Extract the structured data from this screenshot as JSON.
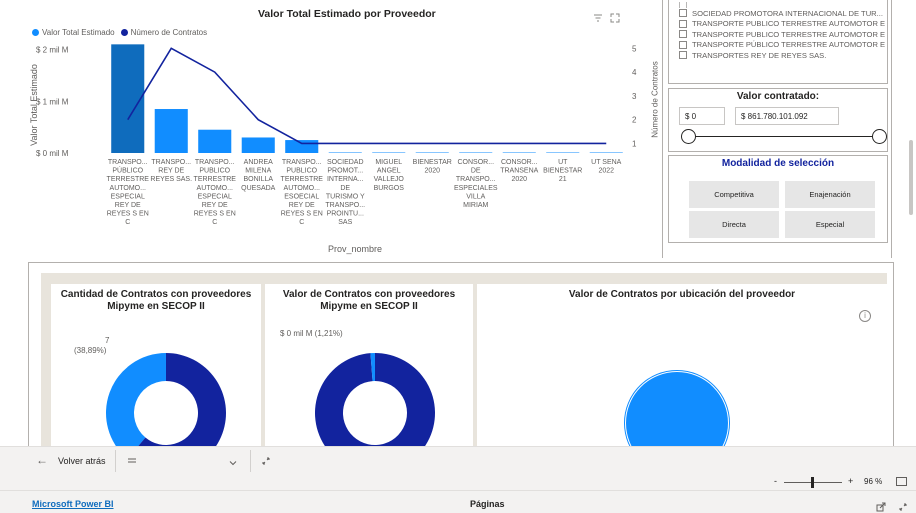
{
  "top_chart": {
    "title": "Valor Total Estimado por Proveedor",
    "legend": [
      {
        "label": "Valor Total Estimado",
        "color": "#118dff"
      },
      {
        "label": "Número de Contratos",
        "color": "#12239e"
      }
    ],
    "y_left_title": "Valor Total Estimado",
    "y_right_title": "Número de Contratos",
    "x_title": "Prov_nombre",
    "y_left_ticks": [
      "$ 2 mil M",
      "$ 1 mil M",
      "$ 0 mil M"
    ],
    "y_right_ticks": [
      "5",
      "4",
      "3",
      "2",
      "1"
    ],
    "focus_icon": "focus-icon",
    "filter_icon": "filter-icon"
  },
  "chart_data": {
    "type": "bar",
    "title": "Valor Total Estimado por Proveedor",
    "xlabel": "Prov_nombre",
    "ylabel": "Valor Total Estimado",
    "y2label": "Número de Contratos",
    "categories": [
      "TRANSPO... PÚBLICO TERRESTRE AUTOMO... ESPECIAL REY DE REYES S EN C",
      "TRANSPO... REY DE REYES SAS.",
      "TRANSPO... PUBLICO TERRESTRE AUTOMO... ESPECIAL REY DE REYES S EN C",
      "ANDREA MILENA BONILLA QUESADA",
      "TRANSPO... PUBLICO TERRESTRE AUTOMO... ESOECIAL REY DE REYES S EN C",
      "SOCIEDAD PROMOT... INTERNA... DE TURISMO Y TRANSPO... PROINTU... SAS",
      "MIGUEL ANGEL VALLEJO BURGOS",
      "BIENESTAR 2020",
      "CONSOR... DE TRANSPO... ESPECIALES VILLA MIRIAM",
      "CONSOR... TRANSENA 2020",
      "UT BIENESTAR 21",
      "UT SENA 2022"
    ],
    "x_label_lines": [
      [
        "TRANSPO...",
        "PÚBLICO",
        "TERRESTRE",
        "AUTOMO...",
        "ESPECIAL",
        "REY DE",
        "REYES S EN",
        "C"
      ],
      [
        "TRANSPO...",
        "REY DE",
        "REYES SAS."
      ],
      [
        "TRANSPO...",
        "PUBLICO",
        "TERRESTRE",
        "AUTOMO...",
        "ESPECIAL",
        "REY DE",
        "REYES S EN",
        "C"
      ],
      [
        "ANDREA",
        "MILENA",
        "BONILLA",
        "QUESADA"
      ],
      [
        "TRANSPO...",
        "PUBLICO",
        "TERRESTRE",
        "AUTOMO...",
        "ESOECIAL",
        "REY DE",
        "REYES S EN",
        "C"
      ],
      [
        "SOCIEDAD",
        "PROMOT...",
        "INTERNA...",
        "DE",
        "TURISMO Y",
        "TRANSPO...",
        "PROINTU...",
        "SAS"
      ],
      [
        "MIGUEL",
        "ANGEL",
        "VALLEJO",
        "BURGOS"
      ],
      [
        "BIENESTAR",
        "2020"
      ],
      [
        "CONSOR...",
        "DE",
        "TRANSPO...",
        "ESPECIALES",
        "VILLA",
        "MIRIAM"
      ],
      [
        "CONSOR...",
        "TRANSENA",
        "2020"
      ],
      [
        "UT",
        "BIENESTAR",
        "21"
      ],
      [
        "UT SENA",
        "2022"
      ]
    ],
    "series": [
      {
        "name": "Valor Total Estimado",
        "axis": "left",
        "kind": "bar",
        "values": [
          2100000000,
          850000000,
          450000000,
          300000000,
          250000000,
          10000000,
          5000000,
          3000000,
          3000000,
          2000000,
          2000000,
          1000000
        ],
        "color": "#118dff",
        "highlight_color": "#0f6cbd"
      },
      {
        "name": "Número de Contratos",
        "axis": "right",
        "kind": "line",
        "values": [
          2,
          5,
          4,
          2,
          1,
          1,
          1,
          1,
          1,
          1,
          1,
          1
        ],
        "color": "#12239e"
      }
    ],
    "ylim": [
      0,
      2300000000
    ],
    "y2lim": [
      0.6,
      5.6
    ],
    "grid": false,
    "legend_position": "top-left"
  },
  "provider_list": {
    "items": [
      "SOCIEDAD PROMOTORA INTERNACIONAL DE TUR...",
      "TRANSPORTE PUBLICO TERRESTRE AUTOMOTOR E...",
      "TRANSPORTE PUBLICO TERRESTRE AUTOMOTOR E...",
      "TRANSPORTE PÚBLICO TERRESTRE AUTOMOTOR E...",
      "TRANSPORTES REY DE REYES SAS."
    ]
  },
  "valor_slicer": {
    "title": "Valor contratado:",
    "min_value": "$ 0",
    "max_value": "$ 861.780.101.092",
    "range_fraction": [
      0,
      1
    ]
  },
  "modalidad": {
    "title": "Modalidad de selección",
    "options": [
      "Competitiva",
      "Enajenación",
      "Directa",
      "Especial"
    ]
  },
  "card1": {
    "title_line1": "Cantidad de Contratos con proveedores",
    "title_line2": "Mipyme en SECOP II",
    "label_value": "7",
    "label_pct": "(38,89%)",
    "donut_fraction": 0.3889,
    "colors": [
      "#118dff",
      "#12239e"
    ]
  },
  "card2": {
    "title_line1": "Valor de Contratos con proveedores",
    "title_line2": "Mipyme en SECOP II",
    "label": "$ 0 mil M (1,21%)",
    "donut_fraction": 0.0121,
    "colors": [
      "#118dff",
      "#12239e"
    ]
  },
  "card3": {
    "title": "Valor de Contratos por ubicación del proveedor",
    "info_icon": "info-icon",
    "color": "#118dff"
  },
  "nav_bar": {
    "back_label": "Volver atrás",
    "back_icon": "arrow-left-icon",
    "pages_icon": "pages-list-icon",
    "chevron_icon": "chevron-down-icon",
    "expand_icon": "expand-icon"
  },
  "zoom_bar": {
    "minus": "-",
    "plus": "+",
    "zoom": "96 %",
    "zoom_fraction": 0.46,
    "fit_icon": "fit-page-icon"
  },
  "footer": {
    "brand": "Microsoft Power BI",
    "pages": "Páginas",
    "share_icon": "share-icon",
    "fullscreen_icon": "fullscreen-icon"
  }
}
